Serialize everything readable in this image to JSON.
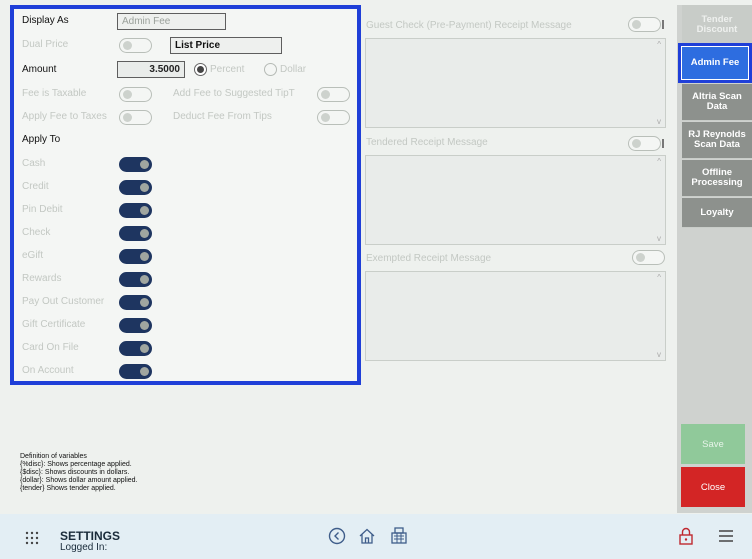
{
  "panel": {
    "display_as_label": "Display As",
    "display_as_value": "Admin Fee",
    "dual_price_label": "Dual Price",
    "list_price_value": "List Price",
    "amount_label": "Amount",
    "amount_value": "3.5000",
    "percent_label": "Percent",
    "dollar_label": "Dollar",
    "fee_taxable_label": "Fee is Taxable",
    "add_fee_tip_label": "Add Fee to Suggested TipT",
    "apply_fee_taxes_label": "Apply Fee to Taxes",
    "deduct_fee_tips_label": "Deduct Fee From Tips",
    "apply_to_label": "Apply To",
    "apply_to_items": [
      {
        "label": "Cash",
        "on": true
      },
      {
        "label": "Credit",
        "on": true
      },
      {
        "label": "Pin Debit",
        "on": true
      },
      {
        "label": "Check",
        "on": true
      },
      {
        "label": "eGift",
        "on": true
      },
      {
        "label": "Rewards",
        "on": true
      },
      {
        "label": "Pay Out Customer",
        "on": true
      },
      {
        "label": "Gift Certificate",
        "on": true
      },
      {
        "label": "Card On File",
        "on": true
      },
      {
        "label": "On Account",
        "on": true
      }
    ]
  },
  "messages": {
    "guest_check_label": "Guest Check (Pre-Payment) Receipt Message",
    "tendered_label": "Tendered Receipt Message",
    "exempted_label": "Exempted Receipt Message"
  },
  "sidebar": {
    "items": [
      {
        "label": "Tender Discount"
      },
      {
        "label": "Admin Fee"
      },
      {
        "label": "Altria Scan Data"
      },
      {
        "label": "RJ Reynolds Scan Data"
      },
      {
        "label": "Offline Processing"
      },
      {
        "label": "Loyalty"
      }
    ],
    "save_label": "Save",
    "close_label": "Close"
  },
  "definitions": {
    "title": "Definition of variables",
    "lines": [
      "{%disc}: Shows percentage applied.",
      "{$disc}:  Shows discounts in dollars.",
      "{dollar}: Shows dollar amount applied.",
      "{tender} Shows tender applied."
    ]
  },
  "bottom_bar": {
    "title": "SETTINGS",
    "subtitle": "Logged In:"
  },
  "colors": {
    "highlight_border": "#1f3fd8",
    "toggle_on": "#1e3560",
    "active_tab": "#2d6de0",
    "save": "#90c99a",
    "close": "#d32525"
  }
}
